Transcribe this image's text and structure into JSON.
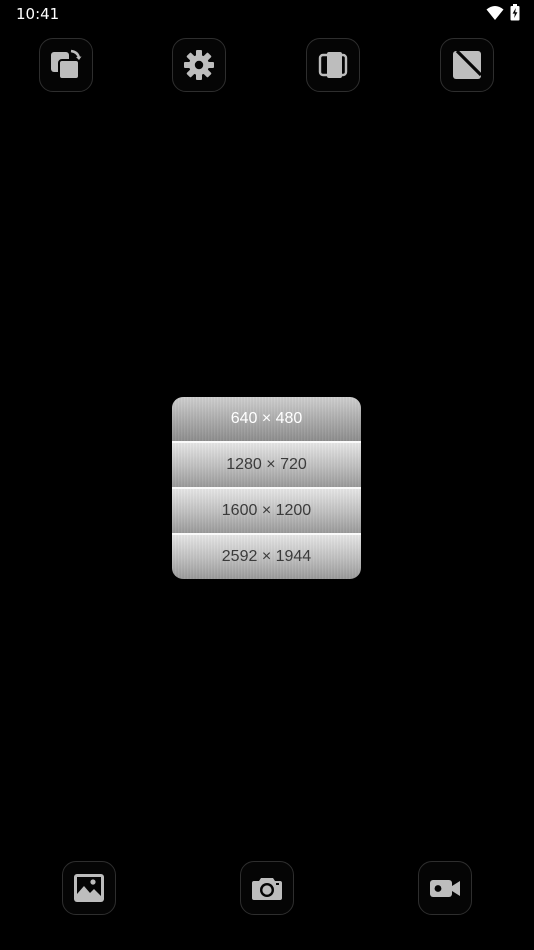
{
  "status_bar": {
    "time": "10:41"
  },
  "top_toolbar": {
    "buttons": [
      {
        "icon": "rotate-images-icon"
      },
      {
        "icon": "gear-icon"
      },
      {
        "icon": "switch-camera-icon"
      },
      {
        "icon": "flip-icon"
      }
    ]
  },
  "resolution_menu": {
    "items": [
      {
        "label": "640 × 480",
        "selected": true
      },
      {
        "label": "1280 × 720",
        "selected": false
      },
      {
        "label": "1600 × 1200",
        "selected": false
      },
      {
        "label": "2592 × 1944",
        "selected": false
      }
    ]
  },
  "bottom_bar": {
    "buttons": [
      {
        "icon": "gallery-icon"
      },
      {
        "icon": "camera-icon"
      },
      {
        "icon": "video-camera-icon"
      }
    ]
  },
  "colors": {
    "background": "#000000",
    "icon": "#bdbdbd",
    "button_border": "#2e2e2e"
  }
}
